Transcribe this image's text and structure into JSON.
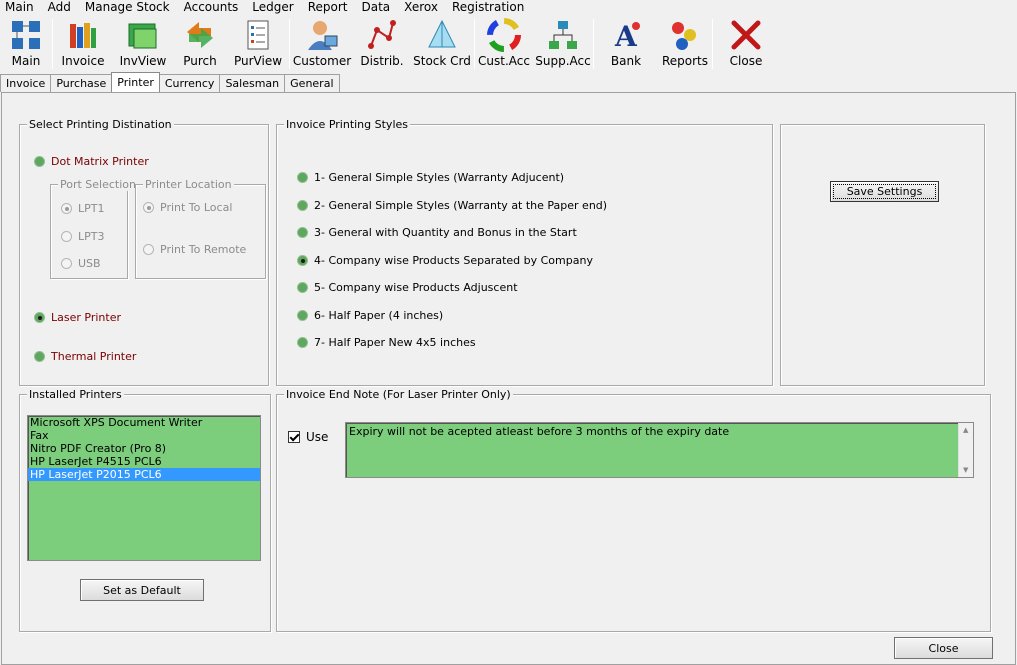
{
  "menu": [
    "Main",
    "Add",
    "Manage Stock",
    "Accounts",
    "Ledger",
    "Report",
    "Data",
    "Xerox",
    "Registration"
  ],
  "toolbar": {
    "main": "Main",
    "invoice": "Invoice",
    "invview": "InvView",
    "purch": "Purch",
    "purview": "PurView",
    "customer": "Customer",
    "distrib": "Distrib.",
    "stockcrd": "Stock Crd",
    "custacc": "Cust.Acc",
    "suppacc": "Supp.Acc",
    "bank": "Bank",
    "reports": "Reports",
    "close": "Close"
  },
  "tabs": [
    "Invoice",
    "Purchase",
    "Printer",
    "Currency",
    "Salesman",
    "General"
  ],
  "destination": {
    "title": "Select Printing Distination",
    "dot_matrix": "Dot Matrix Printer",
    "port_title": "Port Selection",
    "lpt1": "LPT1",
    "lpt3": "LPT3",
    "usb": "USB",
    "location_title": "Printer Location",
    "local": "Print To Local",
    "remote": "Print To Remote",
    "laser": "Laser Printer",
    "thermal": "Thermal Printer"
  },
  "styles": {
    "title": "Invoice Printing Styles",
    "items": [
      "1- General Simple Styles (Warranty Adjucent)",
      "2- General Simple Styles (Warranty at the Paper end)",
      "3- General with Quantity and Bonus in the Start",
      "4- Company wise Products Separated by Company",
      "5- Company wise Products Adjuscent",
      "6- Half Paper (4 inches)",
      "7- Half Paper New 4x5 inches"
    ]
  },
  "save_settings": "Save Settings",
  "installed": {
    "title": "Installed Printers",
    "printers": [
      "Microsoft XPS Document Writer",
      "Fax",
      "Nitro PDF Creator (Pro 8)",
      "HP LaserJet P4515 PCL6",
      "HP LaserJet P2015 PCL6"
    ],
    "set_default": "Set as Default"
  },
  "endnote": {
    "title": "Invoice End Note (For Laser Printer Only)",
    "use": "Use",
    "text": "Expiry will not be acepted atleast before 3 months of the expiry date"
  },
  "close_button": "Close"
}
